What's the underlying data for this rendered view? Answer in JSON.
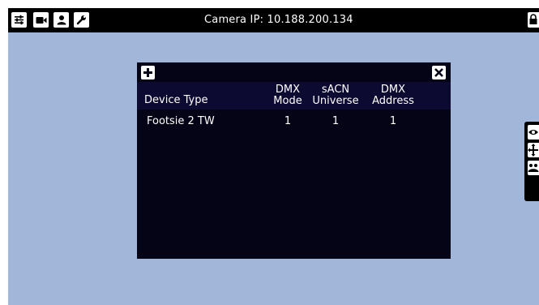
{
  "topbar": {
    "title": "Camera IP: 10.188.200.134",
    "icons": [
      "sliders-icon",
      "video-camera-icon",
      "user-icon",
      "wrench-icon"
    ],
    "lock_icon": "lock-icon"
  },
  "dialog": {
    "add_icon": "plus-icon",
    "close_icon": "close-icon",
    "headers": {
      "device_type": "Device Type",
      "dmx_mode_1": "DMX",
      "dmx_mode_2": "Mode",
      "sacn_universe_1": "sACN",
      "sacn_universe_2": "Universe",
      "dmx_address_1": "DMX",
      "dmx_address_2": "Address"
    },
    "rows": [
      {
        "device_type": "Footsie 2 TW",
        "dmx_mode": "1",
        "sacn_universe": "1",
        "dmx_address": "1"
      }
    ]
  },
  "side_panel": {
    "icons": [
      "eye-icon",
      "move-icon",
      "group-icon"
    ]
  },
  "colors": {
    "background": "#a2b6da",
    "topbar": "#000000",
    "dialog": "#050316",
    "dialog_header": "#0c0a30"
  }
}
